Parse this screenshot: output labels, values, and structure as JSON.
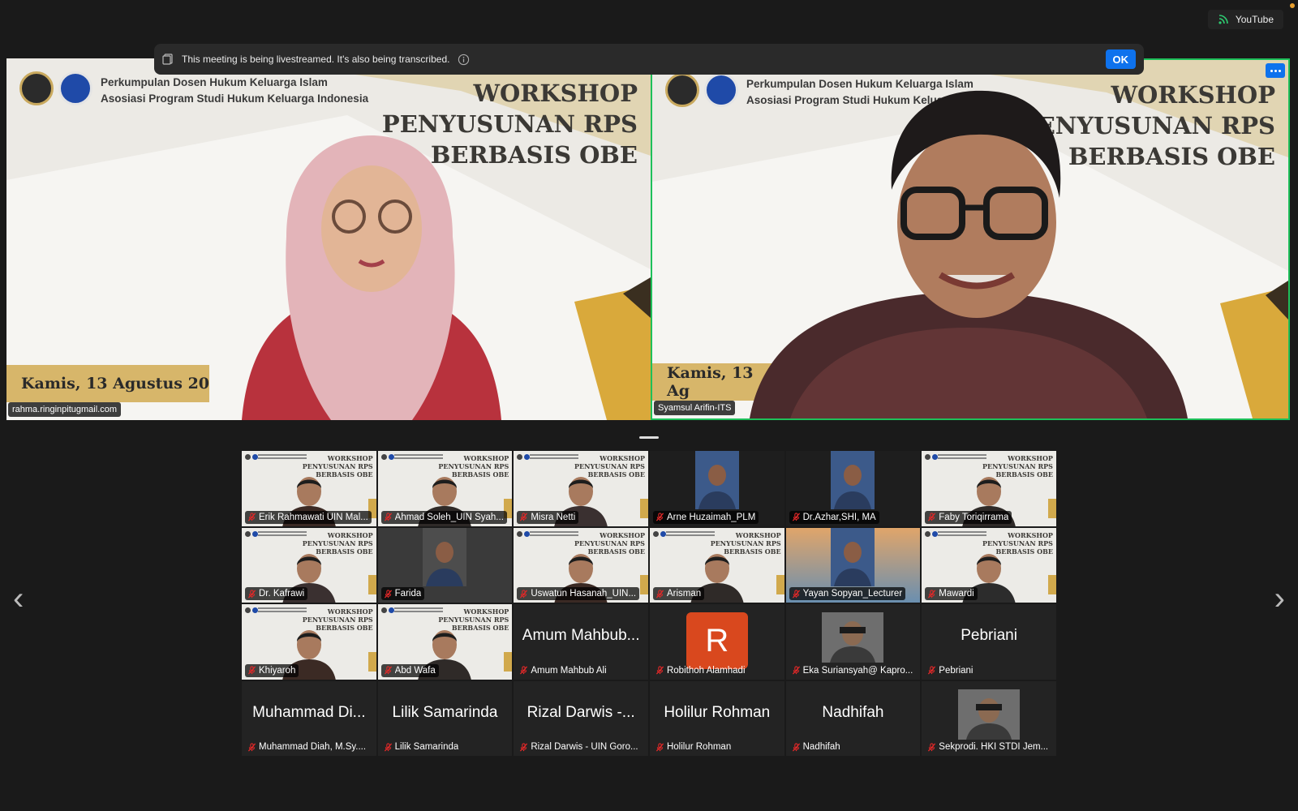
{
  "livestream": {
    "platform": "YouTube"
  },
  "banner": {
    "message": "This meeting is being livestreamed. It's also being transcribed.",
    "ok_label": "OK"
  },
  "slide": {
    "org_line1": "Perkumpulan Dosen Hukum Keluarga Islam",
    "org_line2": "Asosiasi Program Studi Hukum Keluarga Indonesia",
    "title_line1": "WORKSHOP",
    "title_line2": "PENYUSUNAN RPS",
    "title_line3": "BERBASIS OBE",
    "date_left": "Kamis, 13 Agustus 20",
    "date_right": "Kamis, 13 Ag"
  },
  "speakers": [
    {
      "name": "rahma.ringinpitugmail.com"
    },
    {
      "name": "Syamsul Arifin-ITS"
    }
  ],
  "gallery": [
    {
      "name": "Erik Rahmawati UIN Mal...",
      "kind": "ws"
    },
    {
      "name": "Ahmad Soleh_UIN Syah...",
      "kind": "ws"
    },
    {
      "name": "Misra Netti",
      "kind": "ws"
    },
    {
      "name": "Arne Huzaimah_PLM",
      "kind": "video"
    },
    {
      "name": "Dr.Azhar,SHI, MA",
      "kind": "video"
    },
    {
      "name": "Faby Toriqirrama",
      "kind": "ws"
    },
    {
      "name": "Dr. Kafrawi",
      "kind": "ws"
    },
    {
      "name": "Farida",
      "kind": "video"
    },
    {
      "name": "Uswatun Hasanah_UIN...",
      "kind": "ws"
    },
    {
      "name": "Arisman",
      "kind": "ws"
    },
    {
      "name": "Yayan Sopyan_Lecturer",
      "kind": "video"
    },
    {
      "name": "Mawardi",
      "kind": "ws"
    },
    {
      "name": "Khiyaroh",
      "kind": "ws"
    },
    {
      "name": "Abd Wafa",
      "kind": "ws"
    },
    {
      "name": "Amum Mahbub Ali",
      "display": "Amum Mahbub...",
      "kind": "name"
    },
    {
      "name": "Robithoh Alamhadi",
      "initial": "R",
      "kind": "avatar"
    },
    {
      "name": "Eka Suriansyah@ Kapro...",
      "kind": "photo"
    },
    {
      "name": "Pebriani",
      "display": "Pebriani",
      "kind": "name"
    },
    {
      "name": "Muhammad Diah, M.Sy....",
      "display": "Muhammad Di...",
      "kind": "name"
    },
    {
      "name": "Lilik Samarinda",
      "display": "Lilik Samarinda",
      "kind": "name"
    },
    {
      "name": "Rizal Darwis - UIN Goro...",
      "display": "Rizal Darwis -...",
      "kind": "name"
    },
    {
      "name": "Holilur Rohman",
      "display": "Holilur Rohman",
      "kind": "name"
    },
    {
      "name": "Nadhifah",
      "display": "Nadhifah",
      "kind": "name"
    },
    {
      "name": "Sekprodi. HKI STDI Jem...",
      "kind": "photo"
    }
  ],
  "colors": {
    "accent": "#0e72ed",
    "active_speaker": "#1ec05a",
    "muted_mic": "#e02828",
    "gold": "#d1a94c"
  }
}
